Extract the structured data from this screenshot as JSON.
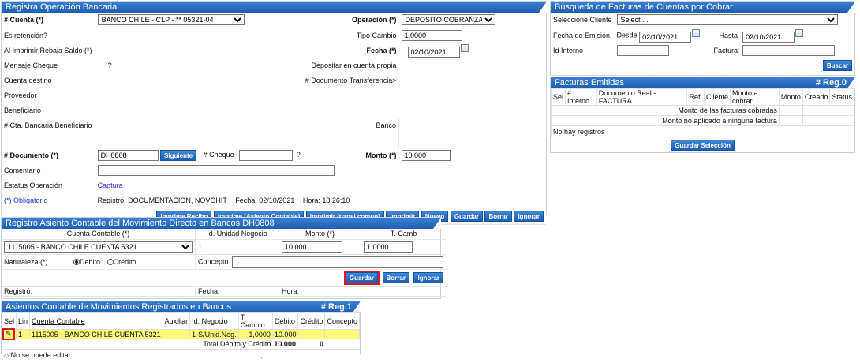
{
  "registra": {
    "title": "Registra Operación Bancaria",
    "cuenta_label": "# Cuenta (*)",
    "cuenta_value": "BANCO CHILE - CLP - ** 05321-04",
    "operacion_label": "Operación (*)",
    "operacion_value": "DEPOSITO COBRANZA",
    "retencion_label": "Es retención?",
    "tipo_cambio_label": "Tipo Cambio",
    "tipo_cambio_value": "1,0000",
    "rebaja_label": "Al Imprimir Rebaja Saldo (*)",
    "fecha_label": "Fecha (*)",
    "fecha_value": "02/10/2021",
    "mensaje_label": "Mensaje Cheque",
    "mensaje_value": "?",
    "depositar_label": "Depositar en cuenta propia",
    "cuenta_destino_label": "Cuenta destino",
    "doc_transf_label": "# Documento Transferencia>",
    "proveedor_label": "Proveedor",
    "beneficiario_label": "Beneficiario",
    "cta_benef_label": "# Cta. Bancaria Beneficiario",
    "banco_label": "Banco",
    "documento_label": "# Documento (*)",
    "documento_value": "DH0808",
    "siguiente_label": "Siguiente",
    "cheque_label": "# Cheque",
    "cheque_q": "?",
    "monto_label": "Monto (*)",
    "monto_value": "10.000",
    "comentario_label": "Comentario",
    "estatus_label": "Estatus Operación",
    "estatus_value": "Captura",
    "obligatorio": "(*) Obligatorio",
    "registro_info": "Registró: DOCUMENTACION, NOVOHIT",
    "fecha_info": "Fecha: 02/10/2021",
    "hora_info": "Hora: 18:26:10",
    "buttons": [
      "Imprime Recibo",
      "Imprime (Asiento Contable)",
      "Imprimir (papel comun)",
      "Imprimir",
      "Nuevo",
      "Guardar",
      "Borrar",
      "Ignorar"
    ]
  },
  "asiento": {
    "title": "Registro Asiento Contable del Movimiento Directo en Bancos DH0808",
    "col_cuenta": "Cuenta Contable (*)",
    "col_unidad": "Id. Unidad Negocio",
    "col_monto": "Monto (*)",
    "col_tcamb": "T. Camb",
    "cuenta_value": "1115005 - BANCO CHILE CUENTA 5321",
    "unidad_value": "1",
    "monto_value": "10.000",
    "tcamb_value": "1,0000",
    "naturaleza_label": "Naturaleza (*)",
    "debito_label": "Debito",
    "credito_label": "Credito",
    "concepto_label": "Concepto",
    "guardar_label": "Guardar",
    "borrar_label": "Borrar",
    "ignorar_label": "Ignorar",
    "registro_label": "Registró:",
    "fecha_label": "Fecha:",
    "hora_label": "Hora:"
  },
  "asientos_reg": {
    "title": "Asientos Contable de Movimientos Registrados en Bancos",
    "count": "# Reg.1",
    "headers": [
      "Sel",
      "Lin",
      "Cuenta Contable",
      "Auxiliar",
      "Id. Negocio",
      "T. Cambio",
      "Débito",
      "Crédito",
      "Concepto"
    ],
    "row": {
      "lin": "1",
      "cuenta": "1115005 - BANCO CHILE CUENTA 5321",
      "auxiliar": "",
      "negocio": "1-S/Unid.Neg.",
      "tcambio": "1,0000",
      "debito": "10.000",
      "credito": "",
      "concepto": ""
    },
    "total_label": "Total Débito y Crédito",
    "total_debito": "10.000",
    "total_credito": "0",
    "no_editar": "No se puede editar",
    "semicolon": ";"
  },
  "busqueda": {
    "title": "Búsqueda de Facturas de Cuentas por Cobrar",
    "cliente_label": "Seleccione Cliente",
    "cliente_placeholder": "Select ...",
    "fecha_emision_label": "Fecha de Emisión",
    "desde_label": "Desde",
    "desde_value": "02/10/2021",
    "hasta_label": "Hasta",
    "hasta_value": "02/10/2021",
    "id_interno_label": "Id Interno",
    "factura_label": "Factura",
    "buscar_label": "Buscar"
  },
  "facturas": {
    "title": "Facturas Emitidas",
    "count": "# Reg.0",
    "headers": [
      "Sel",
      "# Interno",
      "Documento Real - FACTURA",
      "Ref.",
      "Cliente",
      "Monto a cobrar",
      "Monto",
      "Creado",
      "Status"
    ],
    "monto_cobradas": "Monto de las facturas cobradas",
    "monto_no_aplicado": "Monto no aplicado a ninguna factura",
    "no_registros": "No hay registros",
    "guardar_sel_label": "Guardar Selección"
  },
  "colors": {
    "header": "#1c5fb4",
    "highlight": "#e0141e",
    "row_yellow": "#fbfb7a"
  }
}
